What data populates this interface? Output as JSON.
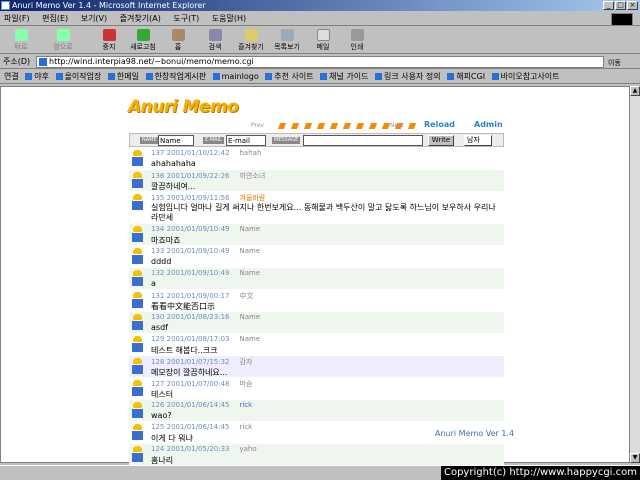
{
  "window": {
    "title": "Anuri Memo Ver 1.4 - Microsoft Internet Explorer",
    "min": "_",
    "max": "□",
    "close": "×"
  },
  "menu": [
    "파일(F)",
    "편집(E)",
    "보기(V)",
    "즐겨찾기(A)",
    "도구(T)",
    "도움말(H)"
  ],
  "toolbar": [
    {
      "label": "뒤로",
      "icon": "back-icon"
    },
    {
      "label": "앞으로",
      "icon": "forward-icon"
    },
    {
      "label": "중지",
      "icon": "stop-icon"
    },
    {
      "label": "새로고침",
      "icon": "refresh-icon"
    },
    {
      "label": "홈",
      "icon": "home-icon"
    },
    {
      "label": "검색",
      "icon": "search-icon"
    },
    {
      "label": "즐겨찾기",
      "icon": "favorites-icon"
    },
    {
      "label": "목록보기",
      "icon": "history-icon"
    },
    {
      "label": "메일",
      "icon": "mail-icon"
    },
    {
      "label": "인쇄",
      "icon": "print-icon"
    }
  ],
  "address": {
    "label": "주소(D)",
    "url": "http://wind.interpia98.net/~bonui/memo/memo.cgi",
    "go": "이동"
  },
  "links": {
    "label": "연결",
    "items": [
      "야후",
      "올이작업장",
      "한메일",
      "한창작업게시판",
      "mainlogo",
      "추천 사이트",
      "채널 가이드",
      "링크 사용자 정의",
      "해피CGI",
      "바이오참고사이트"
    ]
  },
  "app": {
    "logo": "Anuri Memo",
    "prev": "Prev",
    "next": "Next",
    "reload": "Reload",
    "admin": "Admin",
    "form": {
      "name_tag": "NAME",
      "name_value": "Name",
      "email_tag": "E-MAIL",
      "email_value": "E-mail",
      "message_tag": "MESSAGE",
      "message_value": "",
      "write": "Write",
      "gender": "남자"
    },
    "entries": [
      {
        "no": "137",
        "date": "2001/01/10/12:42",
        "name": "hahah",
        "msg": "ahahahaha",
        "style": "",
        "nameColor": ""
      },
      {
        "no": "136",
        "date": "2001/01/09/22:26",
        "name": "하얀소녀",
        "msg": "깔끔하네여...",
        "style": "alt",
        "nameColor": ""
      },
      {
        "no": "135",
        "date": "2001/01/09/11:56",
        "name": "겨울바람",
        "msg": "실험입니다 얼마나 길게 써지나 한번보게요... 동해물과 백두산이 말고 닳도록 하느님이 보우하사 우리나라만세",
        "msg2": "라만세",
        "style": "tall",
        "nameColor": "orange"
      },
      {
        "no": "134",
        "date": "2001/01/09/10:49",
        "name": "Name",
        "msg": "마죠마죠",
        "style": "alt",
        "nameColor": ""
      },
      {
        "no": "133",
        "date": "2001/01/09/10:49",
        "name": "Name",
        "msg": "dddd",
        "style": "",
        "nameColor": ""
      },
      {
        "no": "132",
        "date": "2001/01/09/10:49",
        "name": "Name",
        "msg": "a",
        "style": "alt",
        "nameColor": ""
      },
      {
        "no": "131",
        "date": "2001/01/09/00:17",
        "name": "中文",
        "msg": "看看中文能否口示",
        "style": "",
        "nameColor": ""
      },
      {
        "no": "130",
        "date": "2001/01/08/23:16",
        "name": "Name",
        "msg": "asdf",
        "style": "alt",
        "nameColor": ""
      },
      {
        "no": "129",
        "date": "2001/01/08/17:03",
        "name": "Name",
        "msg": "테스트 해봅다..크크",
        "style": "",
        "nameColor": ""
      },
      {
        "no": "128",
        "date": "2001/01/07/15:32",
        "name": "감자",
        "msg": "메모장이 깔끔하네요...",
        "style": "mine",
        "nameColor": ""
      },
      {
        "no": "127",
        "date": "2001/01/07/00:48",
        "name": "머슴",
        "msg": "테스터",
        "style": "",
        "nameColor": ""
      },
      {
        "no": "126",
        "date": "2001/01/06/14:45",
        "name": "rick",
        "msg": "wao?",
        "style": "alt",
        "nameColor": "blue"
      },
      {
        "no": "125",
        "date": "2001/01/06/14:45",
        "name": "rick",
        "msg": "이게 다 뭐냐",
        "style": "",
        "nameColor": ""
      },
      {
        "no": "124",
        "date": "2001/01/05/20:33",
        "name": "yaho",
        "msg": "홈나리",
        "style": "alt",
        "nameColor": ""
      }
    ],
    "version": "Anuri Memo Ver 1.4"
  },
  "copyright": "Copyright(c) http://www.happycgi.com"
}
